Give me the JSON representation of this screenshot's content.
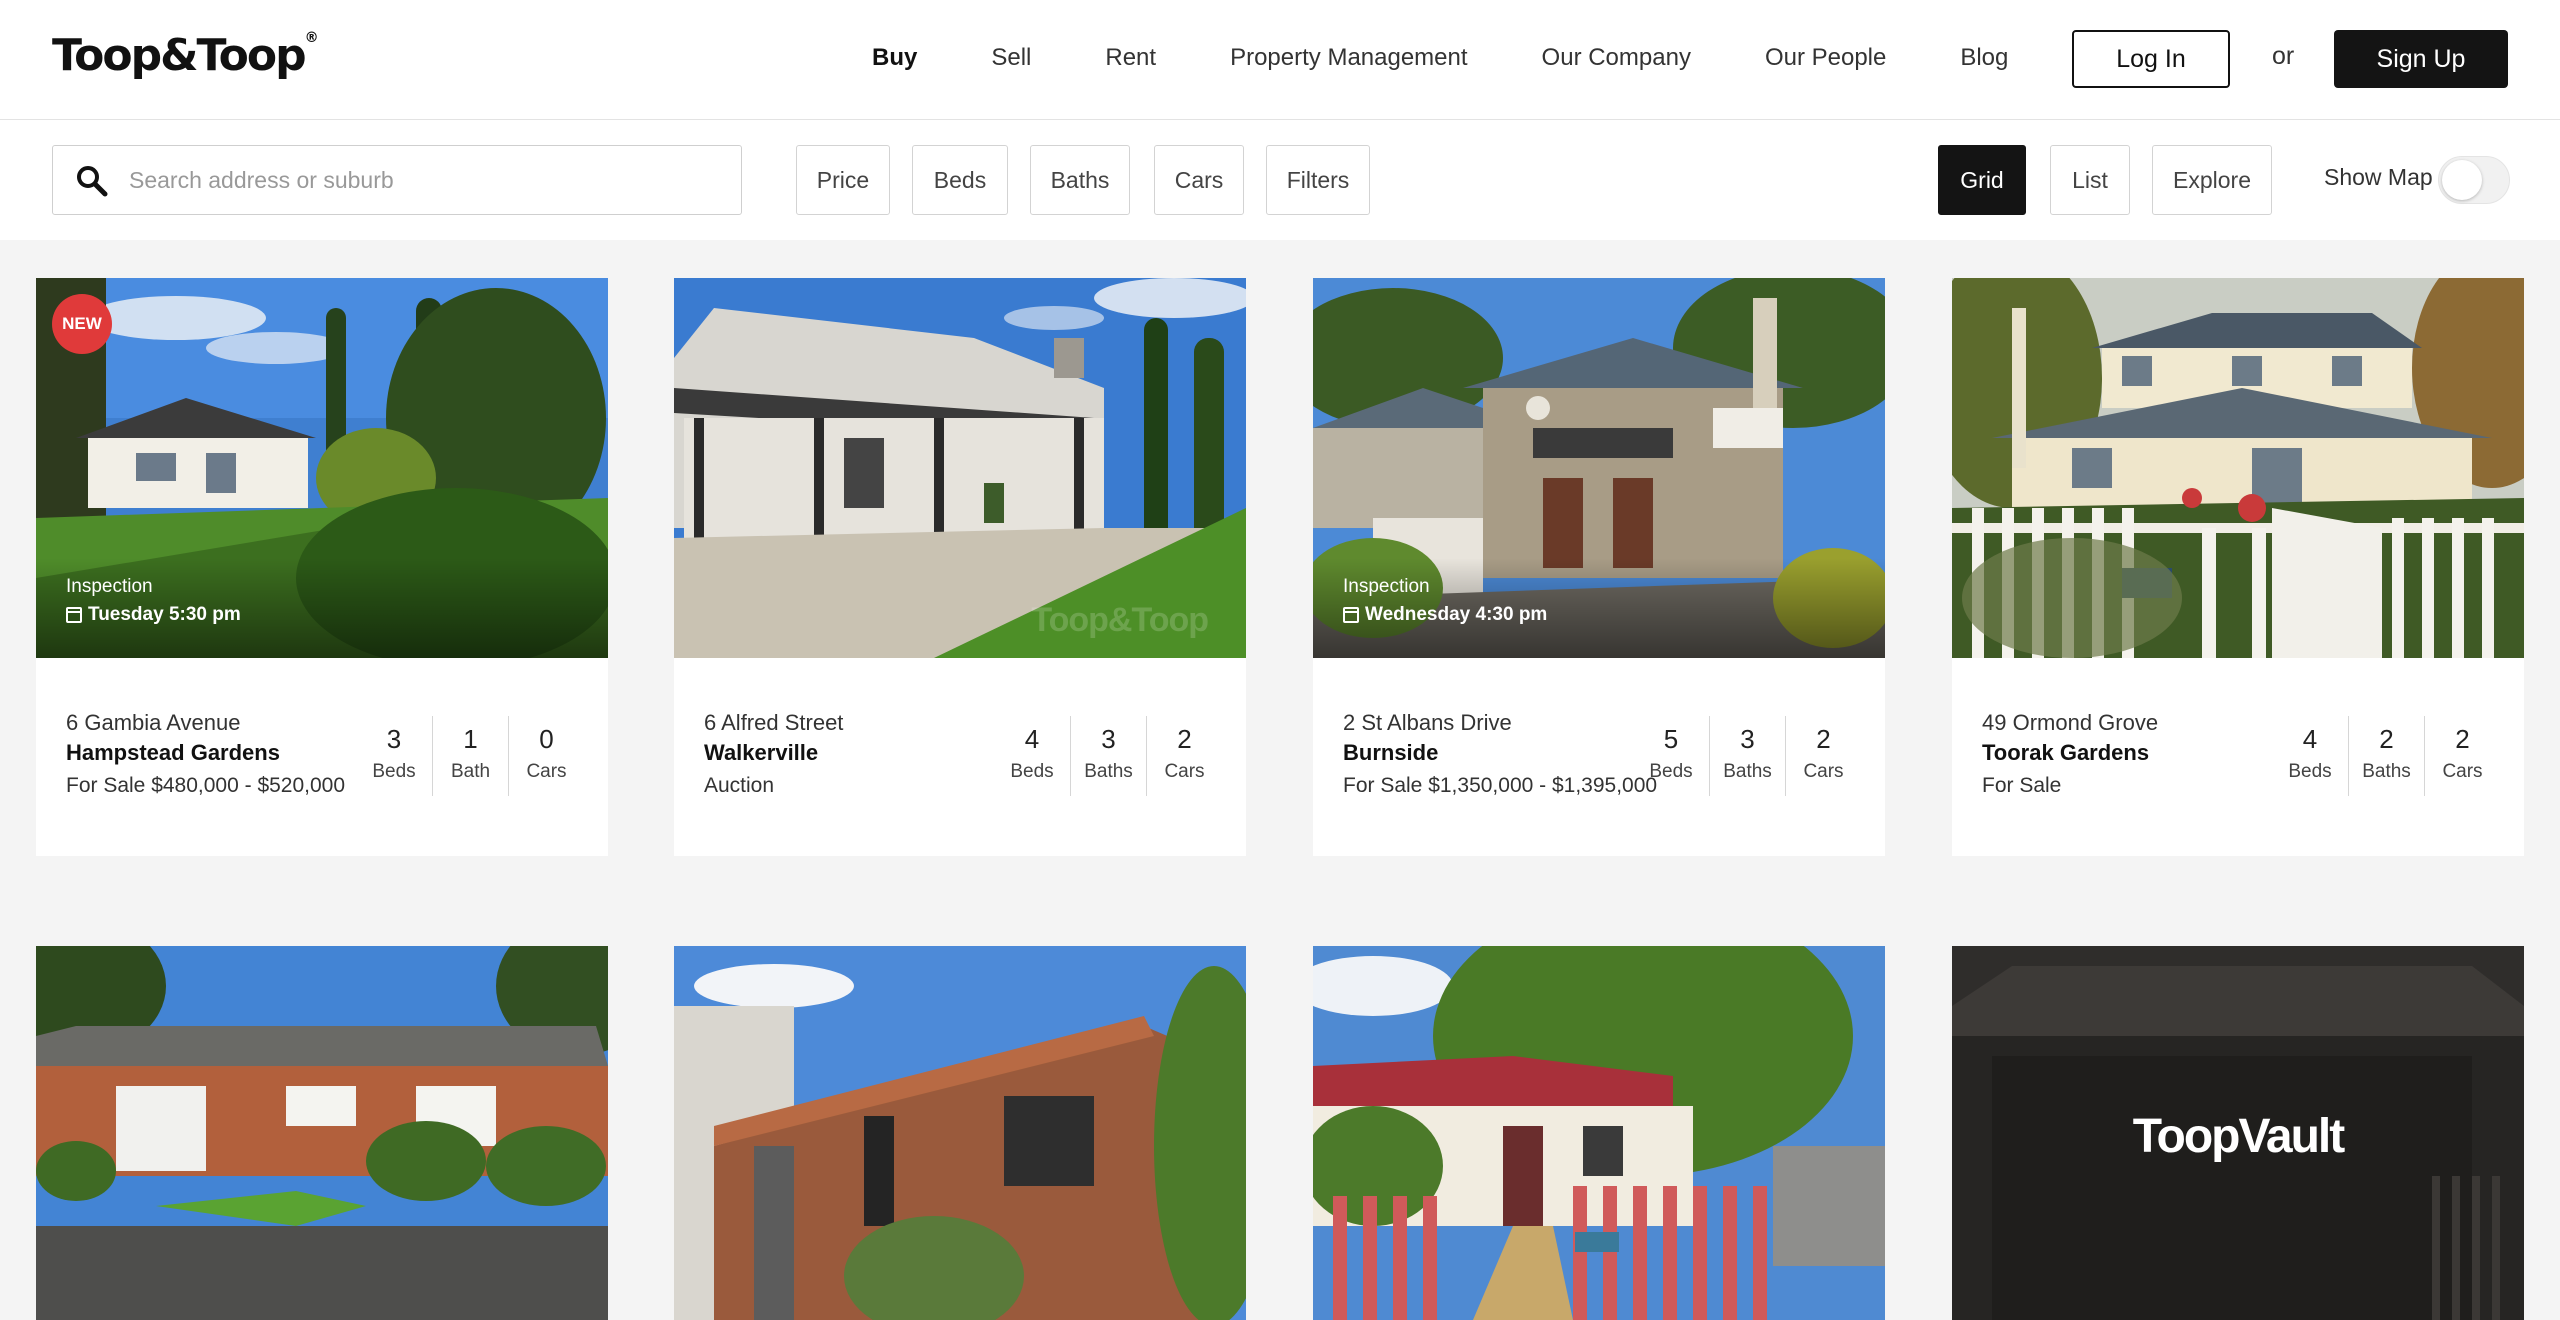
{
  "header": {
    "logo": "Toop&Toop",
    "logo_mark": "®",
    "nav": [
      {
        "label": "Buy",
        "active": true
      },
      {
        "label": "Sell",
        "active": false
      },
      {
        "label": "Rent",
        "active": false
      },
      {
        "label": "Property Management",
        "active": false
      },
      {
        "label": "Our Company",
        "active": false
      },
      {
        "label": "Our People",
        "active": false
      },
      {
        "label": "Blog",
        "active": false
      }
    ],
    "login_label": "Log In",
    "or_label": "or",
    "signup_label": "Sign Up"
  },
  "filters": {
    "search_placeholder": "Search address or suburb",
    "price": "Price",
    "beds": "Beds",
    "baths": "Baths",
    "cars": "Cars",
    "more": "Filters",
    "view_grid": "Grid",
    "view_list": "List",
    "view_explore": "Explore",
    "active_view": "Grid",
    "show_map_label": "Show Map",
    "show_map_on": false
  },
  "listings": [
    {
      "new_badge": "NEW",
      "inspection_label": "Inspection",
      "inspection_time": "Tuesday 5:30 pm",
      "address": "6 Gambia Avenue",
      "suburb": "Hampstead Gardens",
      "status": "For Sale $480,000 - $520,000",
      "beds": "3",
      "beds_label": "Beds",
      "baths": "1",
      "baths_label": "Bath",
      "cars": "0",
      "cars_label": "Cars"
    },
    {
      "address": "6 Alfred Street",
      "suburb": "Walkerville",
      "status": "Auction",
      "beds": "4",
      "beds_label": "Beds",
      "baths": "3",
      "baths_label": "Baths",
      "cars": "2",
      "cars_label": "Cars"
    },
    {
      "inspection_label": "Inspection",
      "inspection_time": "Wednesday 4:30 pm",
      "address": "2 St Albans Drive",
      "suburb": "Burnside",
      "status": "For Sale $1,350,000 - $1,395,000",
      "beds": "5",
      "beds_label": "Beds",
      "baths": "3",
      "baths_label": "Baths",
      "cars": "2",
      "cars_label": "Cars"
    },
    {
      "address": "49 Ormond Grove",
      "suburb": "Toorak Gardens",
      "status": "For Sale",
      "beds": "4",
      "beds_label": "Beds",
      "baths": "2",
      "baths_label": "Baths",
      "cars": "2",
      "cars_label": "Cars"
    }
  ],
  "vault_logo": "ToopVault",
  "colors": {
    "accent_dark": "#141414",
    "new_badge": "#e03a3a",
    "page_bg": "#f4f4f4"
  }
}
